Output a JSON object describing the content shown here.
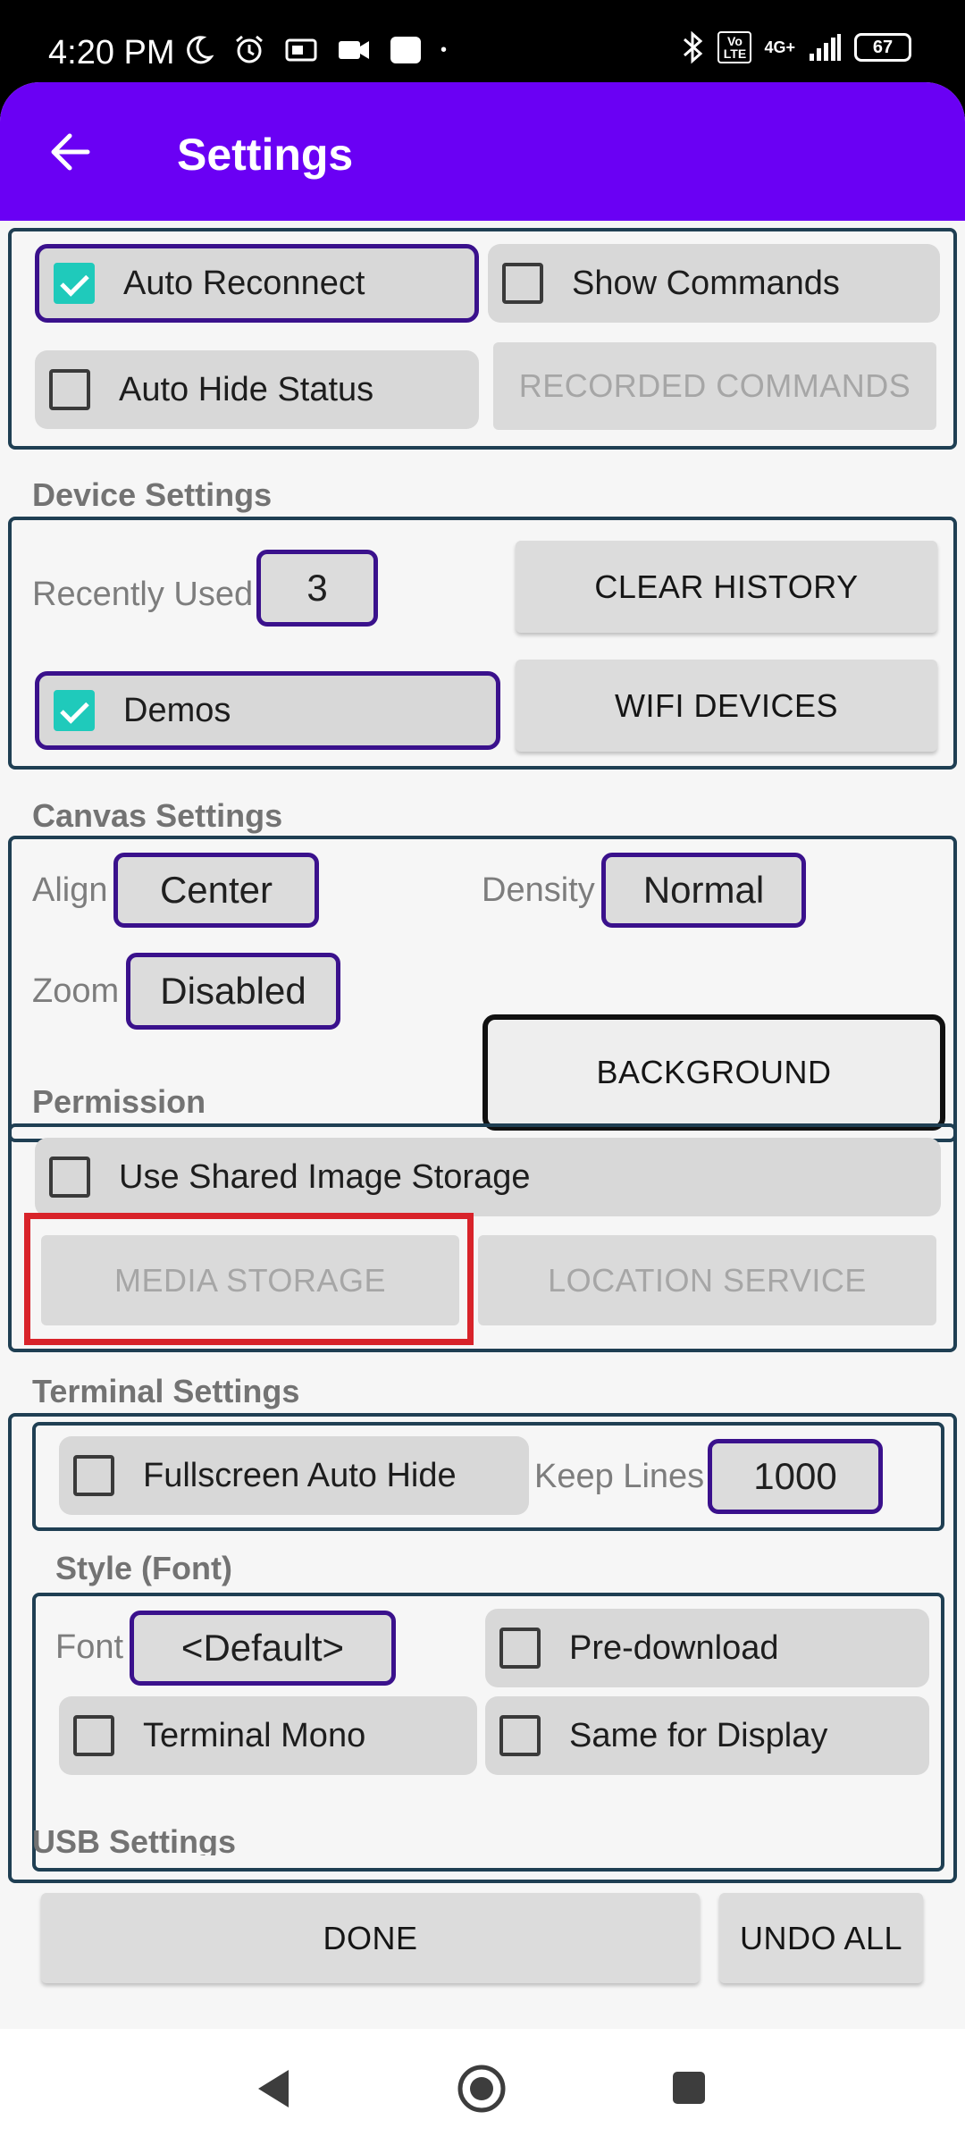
{
  "status_bar": {
    "time": "4:20 PM",
    "left_icons": [
      "moon-icon",
      "alarm-icon",
      "notification-icon",
      "video-icon",
      "app-icon",
      "dot-icon"
    ],
    "right_icons": [
      "bluetooth-icon",
      "volte-icon",
      "signal-icon"
    ],
    "volte": "Vo LTE",
    "network": "4G+",
    "battery": "67"
  },
  "toolbar": {
    "title": "Settings",
    "back_icon": "arrow-left-icon",
    "color": "#6a00f4"
  },
  "general": {
    "auto_reconnect": {
      "label": "Auto Reconnect",
      "checked": true
    },
    "show_commands": {
      "label": "Show Commands",
      "checked": false
    },
    "auto_hide_status": {
      "label": "Auto Hide Status",
      "checked": false
    },
    "recorded_commands": "RECORDED COMMANDS"
  },
  "device_settings": {
    "title": "Device Settings",
    "recently_used_label": "Recently Used",
    "recently_used_value": "3",
    "clear_history": "CLEAR HISTORY",
    "demos": {
      "label": "Demos",
      "checked": true
    },
    "wifi_devices": "WIFI DEVICES"
  },
  "canvas_settings": {
    "title": "Canvas Settings",
    "align_label": "Align",
    "align_value": "Center",
    "density_label": "Density",
    "density_value": "Normal",
    "zoom_label": "Zoom",
    "zoom_value": "Disabled",
    "background": "BACKGROUND"
  },
  "permission": {
    "title": "Permission",
    "use_shared_image_storage": {
      "label": "Use Shared Image Storage",
      "checked": false
    },
    "media_storage": "MEDIA STORAGE",
    "location_service": "LOCATION SERVICE"
  },
  "terminal_settings": {
    "title": "Terminal Settings",
    "fullscreen_auto_hide": {
      "label": "Fullscreen Auto Hide",
      "checked": false
    },
    "keep_lines_label": "Keep Lines",
    "keep_lines_value": "1000",
    "style_title": "Style (Font)",
    "font_label": "Font",
    "font_value": "<Default>",
    "pre_download": {
      "label": "Pre-download",
      "checked": false
    },
    "terminal_mono": {
      "label": "Terminal Mono",
      "checked": false
    },
    "same_for_display": {
      "label": "Same for Display",
      "checked": false
    }
  },
  "usb_settings": {
    "title": "USB Settings"
  },
  "footer": {
    "done": "DONE",
    "undo_all": "UNDO ALL"
  },
  "nav_bar": {
    "icons": [
      "back-triangle-icon",
      "home-circle-icon",
      "recents-square-icon"
    ]
  },
  "colors": {
    "accent": "#6a00f4",
    "checkbox_checked": "#1fcabb",
    "selected_border": "#3a118c",
    "highlight": "#d8232a"
  }
}
